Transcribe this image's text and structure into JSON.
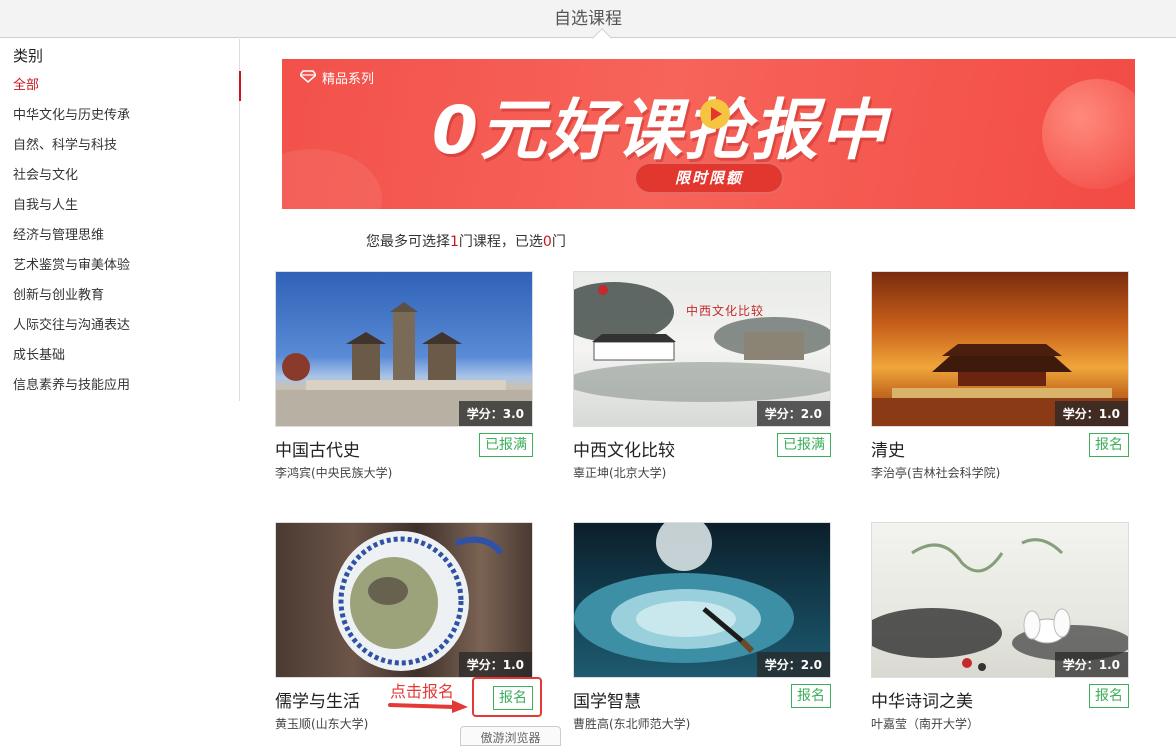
{
  "window": {
    "title": "自选课程"
  },
  "sidebar": {
    "heading": "类别",
    "items": [
      {
        "label": "全部",
        "active": true
      },
      {
        "label": "中华文化与历史传承"
      },
      {
        "label": "自然、科学与科技"
      },
      {
        "label": "社会与文化"
      },
      {
        "label": "自我与人生"
      },
      {
        "label": "经济与管理思维"
      },
      {
        "label": "艺术鉴赏与审美体验"
      },
      {
        "label": "创新与创业教育"
      },
      {
        "label": "人际交往与沟通表达"
      },
      {
        "label": "成长基础"
      },
      {
        "label": "信息素养与技能应用"
      }
    ]
  },
  "banner": {
    "series_label": "精品系列",
    "headline": "0元好课抢报中",
    "pill": "限时限额",
    "gem_icon": "diamond-icon",
    "play_icon": "play-icon"
  },
  "quota": {
    "prefix": "您最多可选择",
    "max": "1",
    "middle": "门课程，已选",
    "selected": "0",
    "suffix": "门"
  },
  "courses": [
    {
      "name": "中国古代史",
      "teacher": "李鸿宾(中央民族大学)",
      "credit": "学分：3.0",
      "status": "已报满"
    },
    {
      "name": "中西文化比较",
      "teacher": "辜正坤(北京大学)",
      "credit": "学分：2.0",
      "status": "已报满"
    },
    {
      "name": "清史",
      "teacher": "李治亭(吉林社会科学院)",
      "credit": "学分：1.0",
      "status": "报名"
    },
    {
      "name": "儒学与生活",
      "teacher": "黄玉顺(山东大学)",
      "credit": "学分：1.0",
      "status": "报名"
    },
    {
      "name": "国学智慧",
      "teacher": "曹胜高(东北师范大学)",
      "credit": "学分：2.0",
      "status": "报名"
    },
    {
      "name": "中华诗词之美",
      "teacher": "叶嘉莹（南开大学）",
      "credit": "学分：1.0",
      "status": "报名"
    }
  ],
  "thumb_text": {
    "comparison_title": "中西文化比较"
  },
  "annotation": {
    "label": "点击报名",
    "color": "#e53935"
  },
  "popup": {
    "label": "傲游浏览器"
  },
  "colors": {
    "accent": "#c8171f",
    "enroll_green": "#3dae5a",
    "banner_red": "#f2514a"
  }
}
